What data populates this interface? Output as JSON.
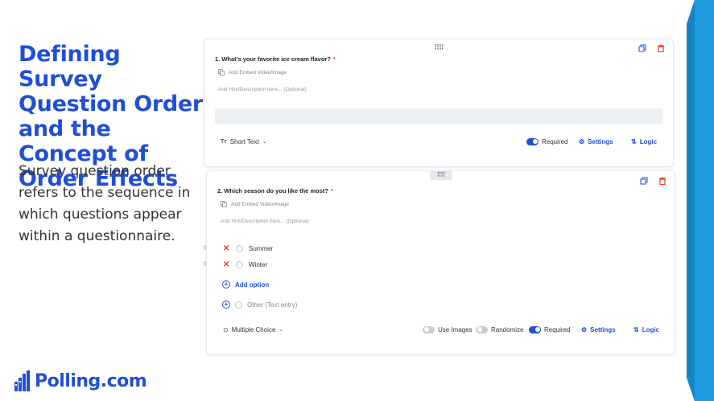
{
  "slide": {
    "title": "Defining Survey Question Order and the Concept of Order Effects",
    "description": "Survey question order refers to the sequence in which questions appear within a questionnaire.",
    "logo_text": "Polling.com",
    "accent_color": "#1f4fd4",
    "side_bar_color": "#1e9be0"
  },
  "question1": {
    "number_title": "1.  What's your favorite ice cream flavor?",
    "required_mark": "*",
    "embed_label": "Add Embed Video/Image",
    "hint_placeholder": "Add Hint/Description here... (Optional)",
    "type_label": "Short Text",
    "required_label": "Required",
    "settings_label": "Settings",
    "logic_label": "Logic"
  },
  "question2": {
    "number_title": "2.  Which season do you like the most?",
    "required_mark": "*",
    "embed_label": "Add Embed Video/Image",
    "hint_placeholder": "Add Hint/Description here... (Optional)",
    "options": [
      "Summer",
      "Winter"
    ],
    "add_option_label": "Add option",
    "other_label": "Other (Text entry)",
    "type_label": "Multiple Choice",
    "use_images_label": "Use Images",
    "randomize_label": "Randomize",
    "required_label": "Required",
    "settings_label": "Settings",
    "logic_label": "Logic"
  }
}
